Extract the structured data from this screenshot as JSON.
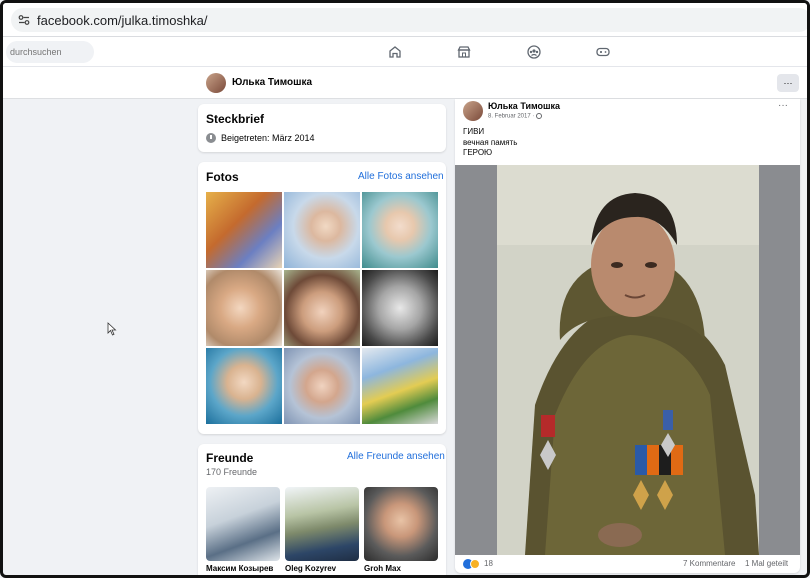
{
  "browser": {
    "url": "facebook.com/julka.timoshka/"
  },
  "fb_header": {
    "search_placeholder": "durchsuchen",
    "nav": [
      {
        "icon": "home-icon"
      },
      {
        "icon": "marketplace-icon"
      },
      {
        "icon": "groups-icon"
      },
      {
        "icon": "gaming-icon"
      }
    ]
  },
  "profile": {
    "name": "Юлька Тимошка",
    "more_label": "···"
  },
  "intro": {
    "title": "Steckbrief",
    "joined": "Beigetreten: März 2014"
  },
  "photos": {
    "title": "Fotos",
    "see_all": "Alle Fotos ansehen"
  },
  "friends": {
    "title": "Freunde",
    "count": "170 Freunde",
    "see_all": "Alle Freunde ansehen",
    "items": [
      {
        "name": "Максим Козырев"
      },
      {
        "name": "Oleg Kozyrev"
      },
      {
        "name": "Groh Max"
      }
    ]
  },
  "post": {
    "author": "Юлька Тимошка",
    "date": "8. Februar 2017 · ",
    "more_label": "···",
    "lines": [
      "ГИВИ",
      "вечная память",
      "ГЕРОЮ"
    ],
    "reactions_count": "18",
    "comments": "7 Kommentare",
    "shares": "1 Mal geteilt"
  },
  "colors": {
    "link": "#216fdb",
    "page_bg": "#f0f2f5",
    "card_bg": "#ffffff"
  }
}
